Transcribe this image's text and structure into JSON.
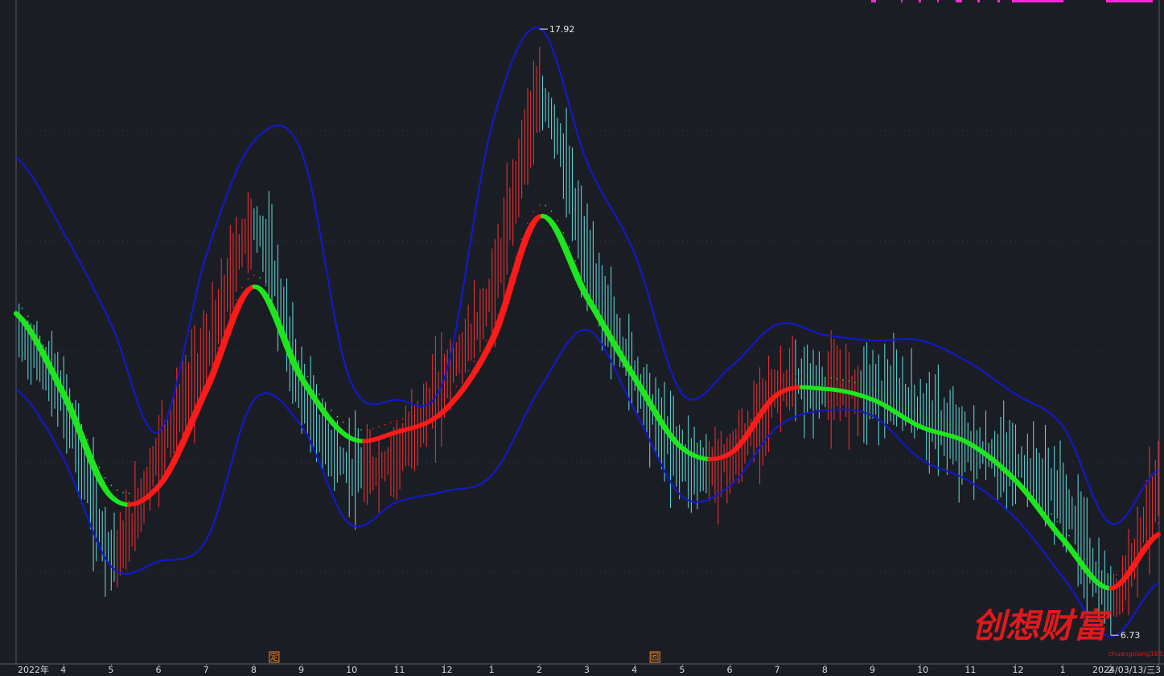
{
  "chart_data": {
    "type": "line",
    "description_of_series": [
      "price",
      "upper_band",
      "lower_band",
      "trend_ribbon"
    ],
    "x": [
      "2022-03",
      "2022-04",
      "2022-05",
      "2022-06",
      "2022-07",
      "2022-08",
      "2022-09",
      "2022-10",
      "2022-11",
      "2022-12",
      "2023-01",
      "2023-02",
      "2023-03",
      "2023-04",
      "2023-05",
      "2023-06",
      "2023-07",
      "2023-08",
      "2023-09",
      "2023-10",
      "2023-11",
      "2023-12",
      "2024-01",
      "2024-02",
      "2024-03"
    ],
    "tick_labels": [
      "2022年",
      "4",
      "5",
      "6",
      "7",
      "8",
      "9",
      "10",
      "11",
      "12",
      "1",
      "2",
      "3",
      "4",
      "5",
      "6",
      "7",
      "8",
      "9",
      "10",
      "11",
      "12",
      "1",
      "2",
      "3",
      "2024/03/13/三"
    ],
    "series": [
      {
        "key": "price",
        "values": [
          12.3,
          11.0,
          8.3,
          10.2,
          12.0,
          14.3,
          11.2,
          9.8,
          10.1,
          11.5,
          13.2,
          16.6,
          13.6,
          11.5,
          10.0,
          10.0,
          11.3,
          11.3,
          11.3,
          10.9,
          10.2,
          9.9,
          9.2,
          7.4,
          9.5
        ]
      },
      {
        "key": "upper_band",
        "values": [
          15.6,
          14.2,
          12.5,
          10.5,
          13.8,
          15.9,
          15.7,
          11.5,
          11.1,
          11.5,
          16.2,
          18.0,
          15.5,
          13.8,
          11.2,
          11.7,
          12.5,
          12.3,
          12.2,
          12.2,
          11.8,
          11.2,
          10.6,
          8.8,
          9.8
        ]
      },
      {
        "key": "lower_band",
        "values": [
          11.3,
          10.0,
          8.0,
          8.1,
          8.5,
          11.1,
          10.6,
          8.8,
          9.2,
          9.4,
          9.7,
          11.3,
          12.4,
          10.9,
          9.3,
          9.5,
          10.6,
          10.9,
          10.8,
          10.0,
          9.6,
          8.9,
          7.8,
          6.7,
          7.7
        ]
      },
      {
        "key": "trend_ribbon",
        "values": [
          12.7,
          11.2,
          9.3,
          9.5,
          11.3,
          13.2,
          11.5,
          10.4,
          10.5,
          10.9,
          12.2,
          14.5,
          13.0,
          11.5,
          10.2,
          10.1,
          11.2,
          11.3,
          11.1,
          10.6,
          10.3,
          9.6,
          8.5,
          7.6,
          8.6
        ]
      }
    ],
    "ribbon_colors": {
      "rising": "#ff1a1a",
      "falling": "#1ee61e"
    },
    "band_color": "#1219c8",
    "annotations": [
      {
        "label": "17.92",
        "x": "2023-02",
        "y": 17.92,
        "kind": "high"
      },
      {
        "label": "6.73",
        "x": "2024-02",
        "y": 6.73,
        "kind": "low"
      }
    ],
    "markers": [
      {
        "label": "定",
        "x": "2022-08"
      },
      {
        "label": "回",
        "x": "2023-04"
      }
    ],
    "grid": true,
    "ylim": [
      6.3,
      18.4
    ]
  },
  "watermark": {
    "text": "创想财富",
    "site": "chuangxiang168.com"
  },
  "colors": {
    "background": "#1b1d24",
    "grid": "#3a3e4c",
    "up_bar": "#ff3030",
    "down_bar": "#66e0e0"
  }
}
